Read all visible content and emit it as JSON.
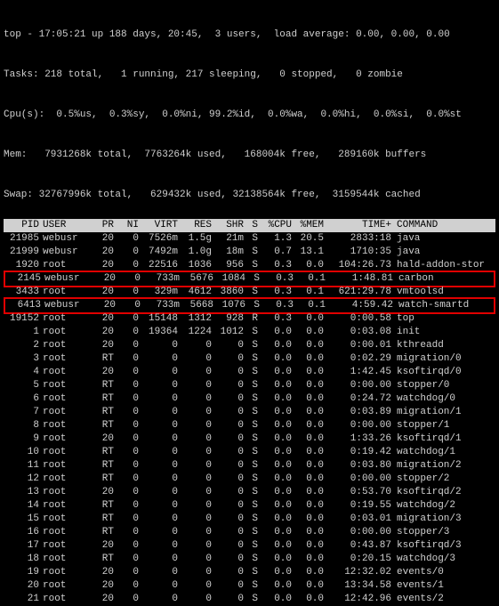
{
  "summary": {
    "line1": "top - 17:05:21 up 188 days, 20:45,  3 users,  load average: 0.00, 0.00, 0.00",
    "line2": "Tasks: 218 total,   1 running, 217 sleeping,   0 stopped,   0 zombie",
    "line3": "Cpu(s):  0.5%us,  0.3%sy,  0.0%ni, 99.2%id,  0.0%wa,  0.0%hi,  0.0%si,  0.0%st",
    "line4": "Mem:   7931268k total,  7763264k used,   168004k free,   289160k buffers",
    "line5": "Swap: 32767996k total,   629432k used, 32138564k free,  3159544k cached"
  },
  "columns": {
    "pid": "PID",
    "user": "USER",
    "pr": "PR",
    "ni": "NI",
    "virt": "VIRT",
    "res": "RES",
    "shr": "SHR",
    "s": "S",
    "cpu": "%CPU",
    "mem": "%MEM",
    "time": "TIME+",
    "command": "COMMAND"
  },
  "rows": [
    {
      "pid": "21985",
      "user": "webusr",
      "pr": "20",
      "ni": "0",
      "virt": "7526m",
      "res": "1.5g",
      "shr": "21m",
      "s": "S",
      "cpu": "1.3",
      "mem": "20.5",
      "time": "2833:18",
      "cmd": "java",
      "hl": false
    },
    {
      "pid": "21999",
      "user": "webusr",
      "pr": "20",
      "ni": "0",
      "virt": "7492m",
      "res": "1.0g",
      "shr": "18m",
      "s": "S",
      "cpu": "0.7",
      "mem": "13.1",
      "time": "1710:35",
      "cmd": "java",
      "hl": false
    },
    {
      "pid": "1920",
      "user": "root",
      "pr": "20",
      "ni": "0",
      "virt": "22516",
      "res": "1036",
      "shr": "956",
      "s": "S",
      "cpu": "0.3",
      "mem": "0.0",
      "time": "104:26.73",
      "cmd": "hald-addon-stor",
      "hl": false
    },
    {
      "pid": "2145",
      "user": "webusr",
      "pr": "20",
      "ni": "0",
      "virt": "733m",
      "res": "5676",
      "shr": "1084",
      "s": "S",
      "cpu": "0.3",
      "mem": "0.1",
      "time": "1:48.81",
      "cmd": "carbon",
      "hl": true
    },
    {
      "pid": "3433",
      "user": "root",
      "pr": "20",
      "ni": "0",
      "virt": "329m",
      "res": "4612",
      "shr": "3860",
      "s": "S",
      "cpu": "0.3",
      "mem": "0.1",
      "time": "621:29.78",
      "cmd": "vmtoolsd",
      "hl": false
    },
    {
      "pid": "6413",
      "user": "webusr",
      "pr": "20",
      "ni": "0",
      "virt": "733m",
      "res": "5668",
      "shr": "1076",
      "s": "S",
      "cpu": "0.3",
      "mem": "0.1",
      "time": "4:59.42",
      "cmd": "watch-smartd",
      "hl": true
    },
    {
      "pid": "19152",
      "user": "root",
      "pr": "20",
      "ni": "0",
      "virt": "15148",
      "res": "1312",
      "shr": "928",
      "s": "R",
      "cpu": "0.3",
      "mem": "0.0",
      "time": "0:00.58",
      "cmd": "top",
      "hl": false
    },
    {
      "pid": "1",
      "user": "root",
      "pr": "20",
      "ni": "0",
      "virt": "19364",
      "res": "1224",
      "shr": "1012",
      "s": "S",
      "cpu": "0.0",
      "mem": "0.0",
      "time": "0:03.08",
      "cmd": "init",
      "hl": false
    },
    {
      "pid": "2",
      "user": "root",
      "pr": "20",
      "ni": "0",
      "virt": "0",
      "res": "0",
      "shr": "0",
      "s": "S",
      "cpu": "0.0",
      "mem": "0.0",
      "time": "0:00.01",
      "cmd": "kthreadd",
      "hl": false
    },
    {
      "pid": "3",
      "user": "root",
      "pr": "RT",
      "ni": "0",
      "virt": "0",
      "res": "0",
      "shr": "0",
      "s": "S",
      "cpu": "0.0",
      "mem": "0.0",
      "time": "0:02.29",
      "cmd": "migration/0",
      "hl": false
    },
    {
      "pid": "4",
      "user": "root",
      "pr": "20",
      "ni": "0",
      "virt": "0",
      "res": "0",
      "shr": "0",
      "s": "S",
      "cpu": "0.0",
      "mem": "0.0",
      "time": "1:42.45",
      "cmd": "ksoftirqd/0",
      "hl": false
    },
    {
      "pid": "5",
      "user": "root",
      "pr": "RT",
      "ni": "0",
      "virt": "0",
      "res": "0",
      "shr": "0",
      "s": "S",
      "cpu": "0.0",
      "mem": "0.0",
      "time": "0:00.00",
      "cmd": "stopper/0",
      "hl": false
    },
    {
      "pid": "6",
      "user": "root",
      "pr": "RT",
      "ni": "0",
      "virt": "0",
      "res": "0",
      "shr": "0",
      "s": "S",
      "cpu": "0.0",
      "mem": "0.0",
      "time": "0:24.72",
      "cmd": "watchdog/0",
      "hl": false
    },
    {
      "pid": "7",
      "user": "root",
      "pr": "RT",
      "ni": "0",
      "virt": "0",
      "res": "0",
      "shr": "0",
      "s": "S",
      "cpu": "0.0",
      "mem": "0.0",
      "time": "0:03.89",
      "cmd": "migration/1",
      "hl": false
    },
    {
      "pid": "8",
      "user": "root",
      "pr": "RT",
      "ni": "0",
      "virt": "0",
      "res": "0",
      "shr": "0",
      "s": "S",
      "cpu": "0.0",
      "mem": "0.0",
      "time": "0:00.00",
      "cmd": "stopper/1",
      "hl": false
    },
    {
      "pid": "9",
      "user": "root",
      "pr": "20",
      "ni": "0",
      "virt": "0",
      "res": "0",
      "shr": "0",
      "s": "S",
      "cpu": "0.0",
      "mem": "0.0",
      "time": "1:33.26",
      "cmd": "ksoftirqd/1",
      "hl": false
    },
    {
      "pid": "10",
      "user": "root",
      "pr": "RT",
      "ni": "0",
      "virt": "0",
      "res": "0",
      "shr": "0",
      "s": "S",
      "cpu": "0.0",
      "mem": "0.0",
      "time": "0:19.42",
      "cmd": "watchdog/1",
      "hl": false
    },
    {
      "pid": "11",
      "user": "root",
      "pr": "RT",
      "ni": "0",
      "virt": "0",
      "res": "0",
      "shr": "0",
      "s": "S",
      "cpu": "0.0",
      "mem": "0.0",
      "time": "0:03.80",
      "cmd": "migration/2",
      "hl": false
    },
    {
      "pid": "12",
      "user": "root",
      "pr": "RT",
      "ni": "0",
      "virt": "0",
      "res": "0",
      "shr": "0",
      "s": "S",
      "cpu": "0.0",
      "mem": "0.0",
      "time": "0:00.00",
      "cmd": "stopper/2",
      "hl": false
    },
    {
      "pid": "13",
      "user": "root",
      "pr": "20",
      "ni": "0",
      "virt": "0",
      "res": "0",
      "shr": "0",
      "s": "S",
      "cpu": "0.0",
      "mem": "0.0",
      "time": "0:53.70",
      "cmd": "ksoftirqd/2",
      "hl": false
    },
    {
      "pid": "14",
      "user": "root",
      "pr": "RT",
      "ni": "0",
      "virt": "0",
      "res": "0",
      "shr": "0",
      "s": "S",
      "cpu": "0.0",
      "mem": "0.0",
      "time": "0:19.55",
      "cmd": "watchdog/2",
      "hl": false
    },
    {
      "pid": "15",
      "user": "root",
      "pr": "RT",
      "ni": "0",
      "virt": "0",
      "res": "0",
      "shr": "0",
      "s": "S",
      "cpu": "0.0",
      "mem": "0.0",
      "time": "0:03.01",
      "cmd": "migration/3",
      "hl": false
    },
    {
      "pid": "16",
      "user": "root",
      "pr": "RT",
      "ni": "0",
      "virt": "0",
      "res": "0",
      "shr": "0",
      "s": "S",
      "cpu": "0.0",
      "mem": "0.0",
      "time": "0:00.00",
      "cmd": "stopper/3",
      "hl": false
    },
    {
      "pid": "17",
      "user": "root",
      "pr": "20",
      "ni": "0",
      "virt": "0",
      "res": "0",
      "shr": "0",
      "s": "S",
      "cpu": "0.0",
      "mem": "0.0",
      "time": "0:43.87",
      "cmd": "ksoftirqd/3",
      "hl": false
    },
    {
      "pid": "18",
      "user": "root",
      "pr": "RT",
      "ni": "0",
      "virt": "0",
      "res": "0",
      "shr": "0",
      "s": "S",
      "cpu": "0.0",
      "mem": "0.0",
      "time": "0:20.15",
      "cmd": "watchdog/3",
      "hl": false
    },
    {
      "pid": "19",
      "user": "root",
      "pr": "20",
      "ni": "0",
      "virt": "0",
      "res": "0",
      "shr": "0",
      "s": "S",
      "cpu": "0.0",
      "mem": "0.0",
      "time": "12:32.02",
      "cmd": "events/0",
      "hl": false
    },
    {
      "pid": "20",
      "user": "root",
      "pr": "20",
      "ni": "0",
      "virt": "0",
      "res": "0",
      "shr": "0",
      "s": "S",
      "cpu": "0.0",
      "mem": "0.0",
      "time": "13:34.58",
      "cmd": "events/1",
      "hl": false
    },
    {
      "pid": "21",
      "user": "root",
      "pr": "20",
      "ni": "0",
      "virt": "0",
      "res": "0",
      "shr": "0",
      "s": "S",
      "cpu": "0.0",
      "mem": "0.0",
      "time": "12:42.96",
      "cmd": "events/2",
      "hl": false
    }
  ]
}
